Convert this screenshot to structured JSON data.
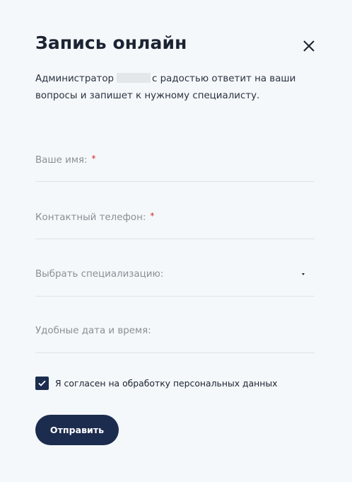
{
  "modal": {
    "title": "Запись онлайн",
    "close_icon": "close-icon",
    "description_before": "Администратор",
    "description_after": "с радостью ответит на ваши вопросы и запишет к нужному специалисту."
  },
  "form": {
    "name": {
      "label": "Ваше имя:",
      "required_mark": "*",
      "value": ""
    },
    "phone": {
      "label": "Контактный телефон:",
      "required_mark": "*",
      "value": ""
    },
    "specialization": {
      "label": "Выбрать специализацию:",
      "icon": "caret-down-icon"
    },
    "datetime": {
      "label": "Удобные дата и время:",
      "value": ""
    },
    "consent": {
      "label": "Я согласен на обработку персональных данных",
      "checked": true
    },
    "submit_label": "Отправить"
  },
  "colors": {
    "background": "#f4f8fa",
    "accent": "#1c2c4f",
    "required": "#d8262c",
    "muted_text": "#8a8f96",
    "divider": "#dfe3e6"
  }
}
